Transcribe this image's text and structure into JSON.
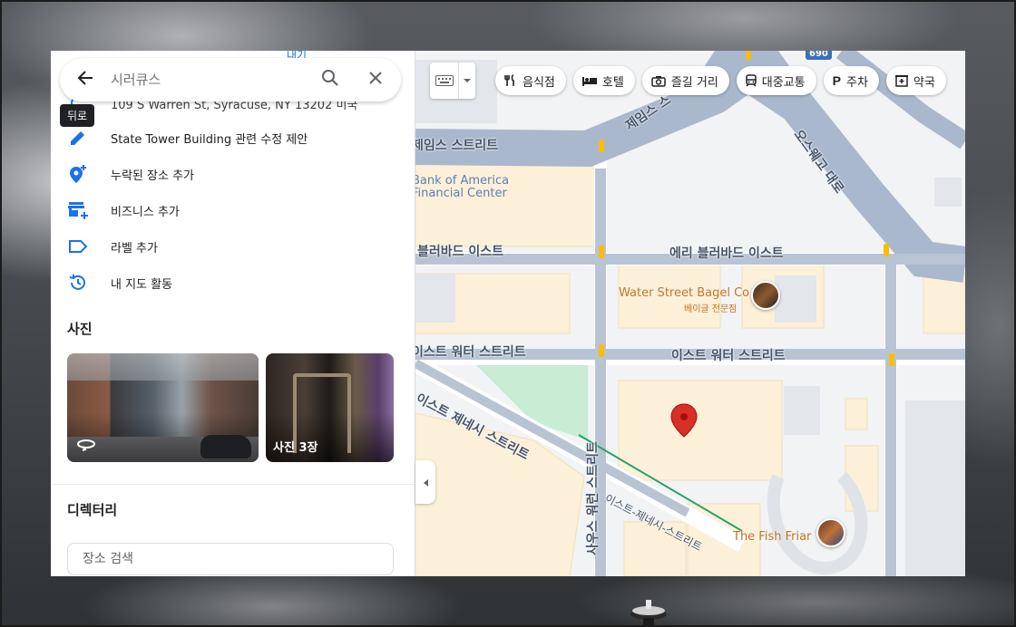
{
  "search": {
    "placeholder": "시러큐스",
    "back_tooltip": "뒤로"
  },
  "panel": {
    "top_partial_text": "내기",
    "partial_address": "109 S Warren St, Syracuse, NY 13202 미국",
    "actions": [
      {
        "icon": "pencil-icon",
        "label": "State Tower Building 관련 수정 제안"
      },
      {
        "icon": "add-place-icon",
        "label": "누락된 장소 추가"
      },
      {
        "icon": "add-business-icon",
        "label": "비즈니스 추가"
      },
      {
        "icon": "label-icon",
        "label": "라벨 추가"
      },
      {
        "icon": "history-icon",
        "label": "내 지도 활동"
      }
    ],
    "photos_title": "사진",
    "photos": [
      {
        "label": "",
        "icon": "360-icon"
      },
      {
        "label": "사진 3장"
      }
    ],
    "directory_title": "디렉터리",
    "directory_search_placeholder": "장소 검색"
  },
  "map_controls": {
    "chips": [
      {
        "icon": "restaurant-icon",
        "label": "음식점"
      },
      {
        "icon": "hotel-icon",
        "label": "호텔"
      },
      {
        "icon": "camera-icon",
        "label": "즐길 거리"
      },
      {
        "icon": "transit-icon",
        "label": "대중교통"
      },
      {
        "icon": "parking-icon",
        "label": "주차"
      },
      {
        "icon": "pharmacy-icon",
        "label": "약국"
      }
    ],
    "route_shield": "690"
  },
  "map": {
    "streets": {
      "james_top": "제임스 스",
      "james_left": "제임스 스트리트",
      "oswego": "오스웨고 대로",
      "erie_left": "블러바드 이스트",
      "erie_right": "에리 블러바드 이스트",
      "water_left": "이스트 워터 스트리트",
      "water_right": "이스트 워터 스트리트",
      "genesee_left": "이스트 제네시 스트리트",
      "genesee_right": "이스트-제네시-스트리트",
      "warren": "사우스 워런 스트리트"
    },
    "pois": {
      "bank_line1": "Bank of America",
      "bank_line2": "Financial Center",
      "bagel": "Water Street Bagel Co",
      "bagel_sub": "베이글 전문점",
      "fish": "The Fish Friar"
    },
    "colors": {
      "road_major": "#a9b8cc",
      "road_minor": "#ffffff",
      "block": "#fdf0d8",
      "park": "#c8ecd4",
      "pin": "#d93025"
    }
  }
}
